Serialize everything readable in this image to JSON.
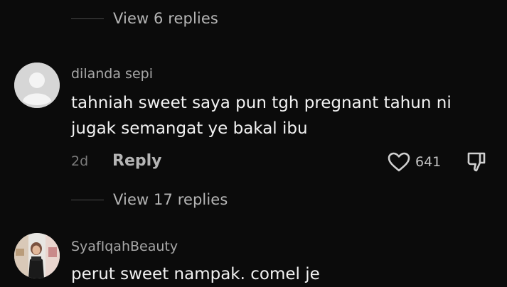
{
  "thread1": {
    "view_replies": "View 6 replies"
  },
  "comment1": {
    "username": "dilanda sepi",
    "text_line1": "tahniah sweet saya pun tgh pregnant tahun ni",
    "text_line2": "jugak semangat ye bakal ibu",
    "time": "2d",
    "reply_label": "Reply",
    "likes": "641",
    "view_replies": "View 17 replies"
  },
  "comment2": {
    "username": "SyafIqahBeauty",
    "text": "perut sweet nampak. comel je"
  },
  "icons": {
    "like": "heart-outline-icon",
    "dislike": "thumbs-down-icon"
  },
  "colors": {
    "background": "#0b0b0b",
    "text_primary": "#f2f2f2",
    "text_secondary": "#a8a8a8",
    "text_muted": "#7b7b7b"
  }
}
